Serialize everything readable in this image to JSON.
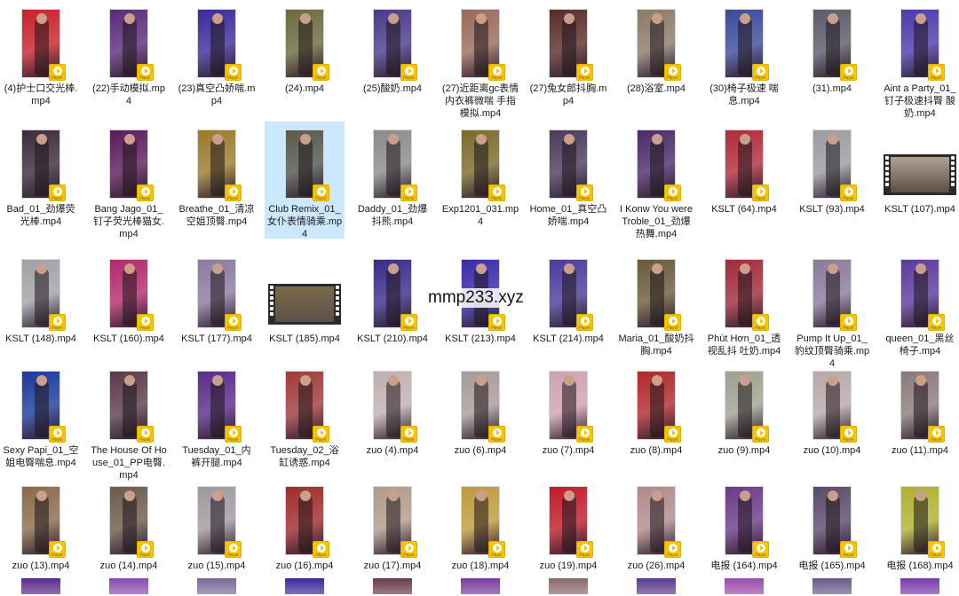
{
  "watermark": "mmp233.xyz",
  "badge_text": "Player",
  "colors": {
    "selection": "#cce8ff",
    "badge": "#f5c400"
  },
  "rows": [
    [
      {
        "name": "(4)护士口交光棒.mp4",
        "tint": "#c8202a"
      },
      {
        "name": "(22)手动模拟.mp4",
        "tint": "#5a2a7a"
      },
      {
        "name": "(23)真空凸娇喘.mp4",
        "tint": "#3a2a9a"
      },
      {
        "name": "(24).mp4",
        "tint": "#6a6a3a"
      },
      {
        "name": "(25)酸奶.mp4",
        "tint": "#4a3a8a"
      },
      {
        "name": "(27)近距离gc表情内衣裤微喘 手指模拟.mp4",
        "tint": "#9a6a5a"
      },
      {
        "name": "(27)兔女郎抖胸.mp4",
        "tint": "#5a2a2a"
      },
      {
        "name": "(28)浴室.mp4",
        "tint": "#8a7a6a"
      },
      {
        "name": "(30)椅子极速 喘息.mp4",
        "tint": "#3a4a9a"
      },
      {
        "name": "(31).mp4",
        "tint": "#5a5a6a"
      },
      {
        "name": "Aint a Party_01_钉子极速抖臀 酸奶.mp4",
        "tint": "#4a3aaa"
      }
    ],
    [
      {
        "name": "Bad_01_劲爆荧光棒.mp4",
        "tint": "#3a2a3a"
      },
      {
        "name": "Bang Jago_01_钉子荧光棒猫女.mp4",
        "tint": "#5a1a5a"
      },
      {
        "name": "Breathe_01_清凉空姐顶臀.mp4",
        "tint": "#9a7a2a"
      },
      {
        "name": "Club Remix_01_女仆表情骑乘.mp4",
        "tint": "#5a5a4a",
        "selected": true
      },
      {
        "name": "Daddy_01_劲爆抖熊.mp4",
        "tint": "#8a8a8a"
      },
      {
        "name": "Exp1201_031.mp4",
        "tint": "#7a6a2a"
      },
      {
        "name": "Home_01_真空凸娇喘.mp4",
        "tint": "#4a3a5a"
      },
      {
        "name": "I Konw You were Troble_01_劲爆热舞.mp4",
        "tint": "#4a2a6a"
      },
      {
        "name": "KSLT (64).mp4",
        "tint": "#b02a3a"
      },
      {
        "name": "KSLT (93).mp4",
        "tint": "#9a9aa0"
      },
      {
        "name": "KSLT (107).mp4",
        "tint": "#b0a090",
        "film": true
      }
    ],
    [
      {
        "name": "KSLT (148).mp4",
        "tint": "#a0a0a8"
      },
      {
        "name": "KSLT (160).mp4",
        "tint": "#b02a6a"
      },
      {
        "name": "KSLT (177).mp4",
        "tint": "#8a7aa0"
      },
      {
        "name": "KSLT (185).mp4",
        "tint": "#7a6a4a",
        "film": true
      },
      {
        "name": "KSLT (210).mp4",
        "tint": "#3a2a8a"
      },
      {
        "name": "KSLT (213).mp4",
        "tint": "#3a2aaa"
      },
      {
        "name": "KSLT (214).mp4",
        "tint": "#4a3a9a"
      },
      {
        "name": "Maria_01_酸奶抖胸.mp4",
        "tint": "#6a5a3a"
      },
      {
        "name": "Phút Hơn_01_透视乱抖 吐奶.mp4",
        "tint": "#a02a3a"
      },
      {
        "name": "Pump It Up_01_豹纹顶臀骑乘.mp4",
        "tint": "#8a7a9a"
      },
      {
        "name": "queen_01_黑丝椅子.mp4",
        "tint": "#5a3a9a"
      }
    ],
    [
      {
        "name": "Sexy Papi_01_空姐电臀喘息.mp4",
        "tint": "#1a3a9a"
      },
      {
        "name": "The House Of House_01_PP电臀.mp4",
        "tint": "#5a3a4a"
      },
      {
        "name": "Tuesday_01_内裤开腿.mp4",
        "tint": "#5a2a8a"
      },
      {
        "name": "Tuesday_02_浴缸诱惑.mp4",
        "tint": "#a03a3a"
      },
      {
        "name": "zuo (4).mp4",
        "tint": "#c0b0b0"
      },
      {
        "name": "zuo (6).mp4",
        "tint": "#a89a98"
      },
      {
        "name": "zuo (7).mp4",
        "tint": "#d0a0b0"
      },
      {
        "name": "zuo (8).mp4",
        "tint": "#b0282a"
      },
      {
        "name": "zuo (9).mp4",
        "tint": "#a0a090"
      },
      {
        "name": "zuo (10).mp4",
        "tint": "#b8a8a8"
      },
      {
        "name": "zuo (11).mp4",
        "tint": "#8a7a7a"
      }
    ],
    [
      {
        "name": "zuo (13).mp4",
        "tint": "#8a6a4a"
      },
      {
        "name": "zuo (14).mp4",
        "tint": "#6a5a4a"
      },
      {
        "name": "zuo (15).mp4",
        "tint": "#a098a0"
      },
      {
        "name": "zuo (16).mp4",
        "tint": "#a02a2a"
      },
      {
        "name": "zuo (17).mp4",
        "tint": "#b09a8a"
      },
      {
        "name": "zuo (18).mp4",
        "tint": "#c09a3a"
      },
      {
        "name": "zuo (19).mp4",
        "tint": "#c01a2a"
      },
      {
        "name": "zuo (26).mp4",
        "tint": "#b08a8a"
      },
      {
        "name": "电报 (164).mp4",
        "tint": "#6a3a8a"
      },
      {
        "name": "电报 (165).mp4",
        "tint": "#5a4a6a"
      },
      {
        "name": "电报 (168).mp4",
        "tint": "#b0b030"
      }
    ],
    [
      {
        "name": "",
        "tint": "#5a2a8a"
      },
      {
        "name": "",
        "tint": "#8a4aaa"
      },
      {
        "name": "",
        "tint": "#7a6a9a"
      },
      {
        "name": "",
        "tint": "#3a2a9a"
      },
      {
        "name": "",
        "tint": "#6a3a4a"
      },
      {
        "name": "",
        "tint": "#7a3a9a"
      },
      {
        "name": "",
        "tint": "#8a6a6a"
      },
      {
        "name": "",
        "tint": "#5a3a8a"
      },
      {
        "name": "",
        "tint": "#9a4aaa"
      },
      {
        "name": "",
        "tint": "#6a5a8a"
      },
      {
        "name": "",
        "tint": "#7a3aaa"
      }
    ]
  ]
}
